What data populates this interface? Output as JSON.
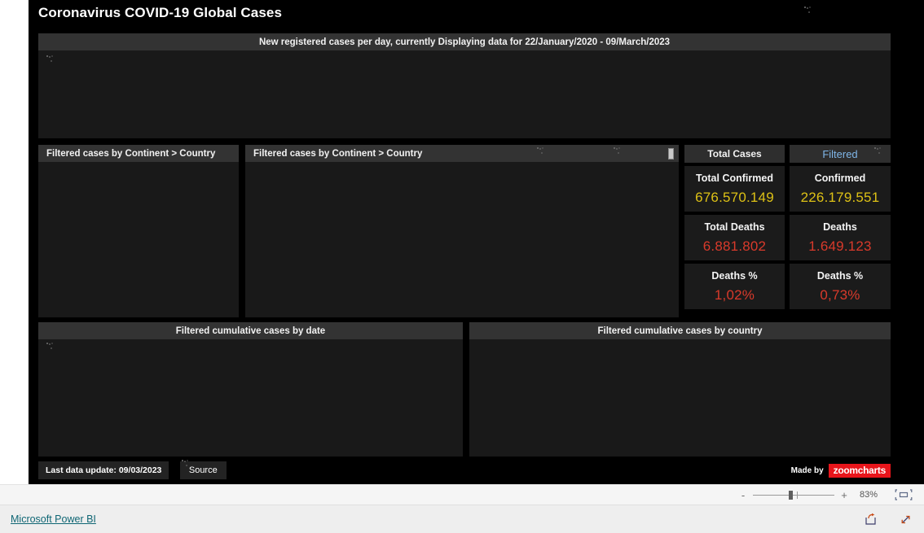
{
  "report": {
    "title": "Coronavirus COVID-19 Global Cases",
    "banner": "New registered cases per day, currently Displaying data for 22/January/2020 - 09/March/2023"
  },
  "panels": {
    "tree_left_title": "Filtered cases by Continent > Country",
    "tree_right_title": "Filtered cases by Continent > Country",
    "cumulative_date_title": "Filtered cumulative cases by date",
    "cumulative_country_title": "Filtered cumulative cases by country"
  },
  "kpi": {
    "total": {
      "header": "Total Cases",
      "cards": [
        {
          "label": "Total Confirmed",
          "value": "676.570.149",
          "color": "#ddc116"
        },
        {
          "label": "Total Deaths",
          "value": "6.881.802",
          "color": "#d93a2b"
        },
        {
          "label": "Deaths %",
          "value": "1,02%",
          "color": "#d93a2b"
        }
      ]
    },
    "filtered": {
      "header": "Filtered",
      "cards": [
        {
          "label": "Confirmed",
          "value": "226.179.551",
          "color": "#ddc116"
        },
        {
          "label": "Deaths",
          "value": "1.649.123",
          "color": "#d93a2b"
        },
        {
          "label": "Deaths %",
          "value": "0,73%",
          "color": "#d93a2b"
        }
      ]
    }
  },
  "footer": {
    "last_update": "Last data update: 09/03/2023",
    "source_button": "Source",
    "made_by": "Made by",
    "brand": "zoomcharts"
  },
  "zoombar": {
    "minus": "-",
    "plus": "+",
    "zoom_level": "83%",
    "fit_icon": "fit-to-page-icon"
  },
  "statusbar": {
    "powerbi_link": "Microsoft Power BI",
    "share_icon": "share-icon",
    "fullscreen_icon": "fullscreen-icon"
  }
}
